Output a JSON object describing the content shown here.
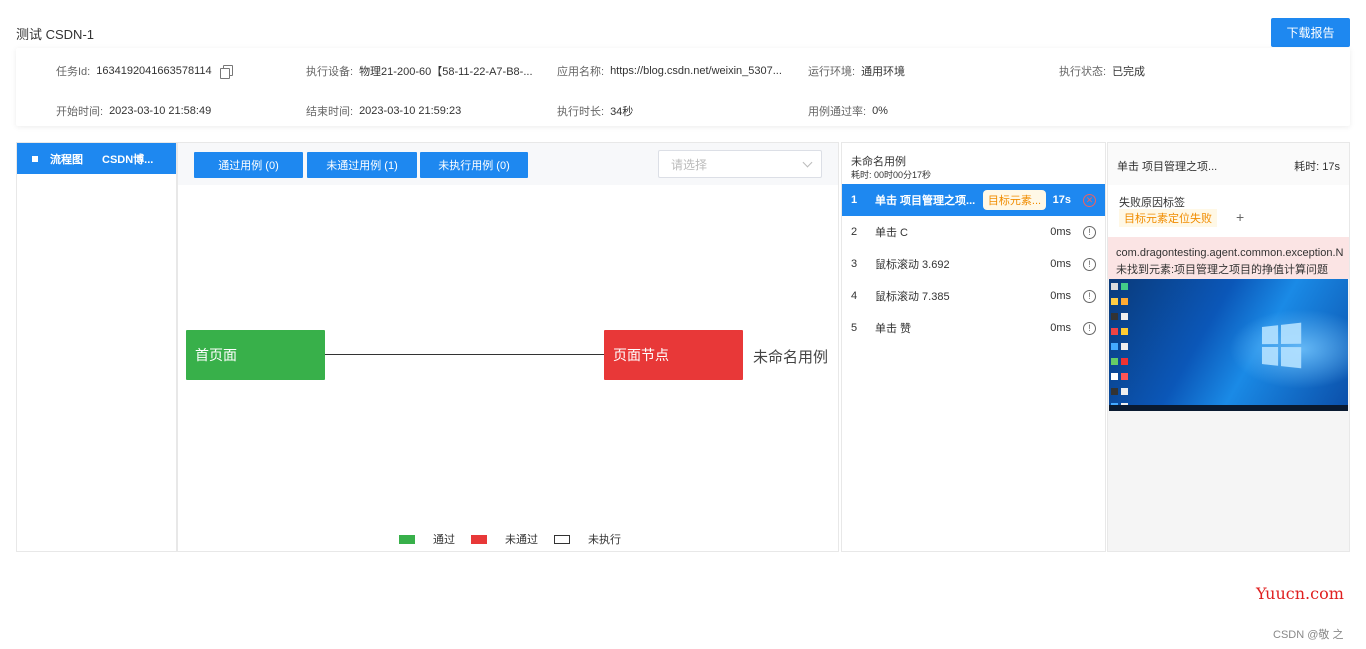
{
  "page": {
    "title": "测试 CSDN-1",
    "download_label": "下载报告"
  },
  "info": {
    "task_id_label": "任务Id:",
    "task_id": "1634192041663578114",
    "device_label": "执行设备:",
    "device": "物理21-200-60【58-11-22-A7-B8-...",
    "app_label": "应用名称:",
    "app": "https://blog.csdn.net/weixin_5307...",
    "env_label": "运行环境:",
    "env": "通用环境",
    "status_label": "执行状态:",
    "status": "已完成",
    "start_label": "开始时间:",
    "start": "2023-03-10 21:58:49",
    "end_label": "结束时间:",
    "end": "2023-03-10 21:59:23",
    "duration_label": "执行时长:",
    "duration": "34秒",
    "pass_rate_label": "用例通过率:",
    "pass_rate": "0%"
  },
  "tree": {
    "item_label": "流程图",
    "item_name": "CSDN博..."
  },
  "toolbar": {
    "passed": "通过用例 (0)",
    "failed": "未通过用例 (1)",
    "not_run": "未执行用例 (0)",
    "select_placeholder": "请选择"
  },
  "flow": {
    "start_node": "首页面",
    "end_node": "页面节点",
    "case_label": "未命名用例"
  },
  "legend": {
    "pass": "通过",
    "fail": "未通过",
    "not_run": "未执行"
  },
  "colors": {
    "accent": "#1e88f0",
    "pass": "#38b04a",
    "fail": "#e83838",
    "warn": "#f08c00"
  },
  "steps": {
    "title": "未命名用例",
    "duration": "耗时: 00时00分17秒",
    "rows": [
      {
        "num": "1",
        "name": "单击 项目管理之项...",
        "tag": "目标元素...",
        "time": "17s",
        "icon": "error-icon"
      },
      {
        "num": "2",
        "name": "单击 C",
        "time": "0ms",
        "icon": "info-icon"
      },
      {
        "num": "3",
        "name": "鼠标滚动 3.692",
        "time": "0ms",
        "icon": "info-icon"
      },
      {
        "num": "4",
        "name": "鼠标滚动 7.385",
        "time": "0ms",
        "icon": "info-icon"
      },
      {
        "num": "5",
        "name": "单击 赞",
        "time": "0ms",
        "icon": "info-icon"
      }
    ]
  },
  "detail": {
    "title": "单击 项目管理之项...",
    "duration": "耗时: 17s",
    "reason_label": "失败原因标签",
    "reason_tag": "目标元素定位失败",
    "add_symbol": "+",
    "exception_line1": "com.dragontesting.agent.common.exception.N",
    "exception_line2": "未找到元素:项目管理之项目的挣值计算问题"
  },
  "footer": {
    "watermark": "Yuucn.com",
    "credit": "CSDN @敬 之"
  }
}
